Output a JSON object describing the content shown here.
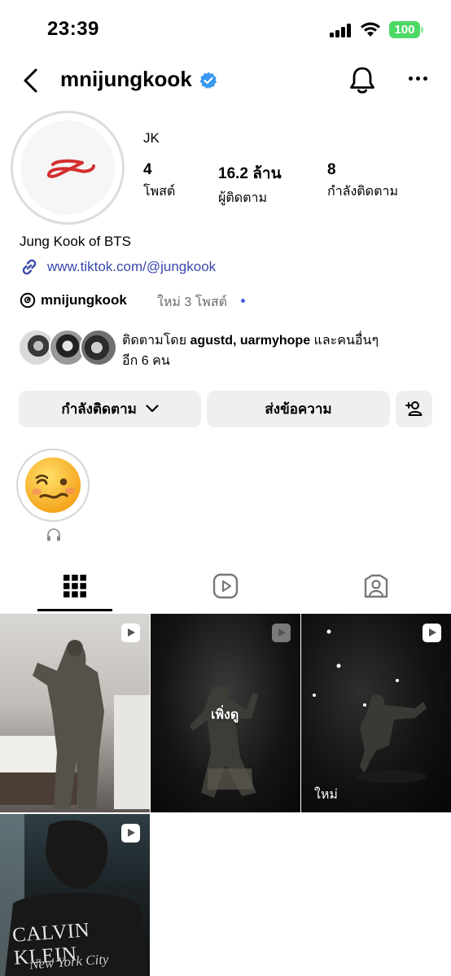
{
  "status_bar": {
    "time": "23:39",
    "battery": "100",
    "battery_color": "#4cd964"
  },
  "header": {
    "username": "mnijungkook"
  },
  "profile": {
    "display_name": "JK",
    "stats": [
      {
        "value": "4",
        "label": "โพสต์"
      },
      {
        "value": "16.2 ล้าน",
        "label": "ผู้ติดตาม"
      },
      {
        "value": "8",
        "label": "กำลังติดตาม"
      }
    ],
    "bio": "Jung Kook of BTS",
    "link": "www.tiktok.com/@jungkook",
    "threads": {
      "name": "mnijungkook",
      "new_posts": "ใหม่ 3 โพสต์"
    }
  },
  "mutual": {
    "prefix": "ติดตามโดย ",
    "names": "agustd, uarmyhope",
    "suffix": " และคนอื่นๆ",
    "line2": "อีก 6 คน"
  },
  "buttons": {
    "following": "กำลังติดตาม",
    "message": "ส่งข้อความ"
  },
  "highlight": {
    "icon": "headphones-icon"
  },
  "tabs": [
    "grid-icon",
    "reels-icon",
    "tagged-icon"
  ],
  "grid": [
    {
      "overlay": ""
    },
    {
      "overlay": "เพิ่งดู"
    },
    {
      "overlay": "ใหม่"
    },
    {
      "overlay": "CALVIN KLEIN",
      "sub": "New York City"
    }
  ],
  "colors": {
    "verified": "#3897f0",
    "link": "#3949ab",
    "logo": "#d32f2f"
  }
}
